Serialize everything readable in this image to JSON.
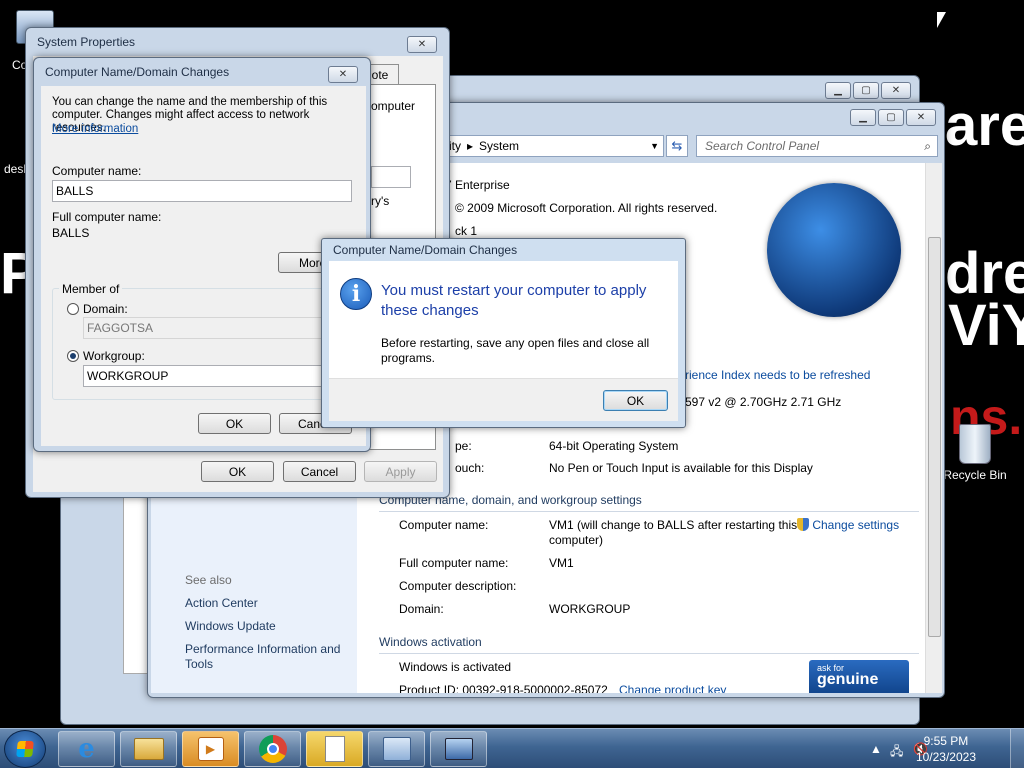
{
  "desktop": {
    "bg_text_1": "are!",
    "bg_text_2": "dres",
    "bg_text_3": "ViY",
    "bg_text_4": "ns.",
    "bg_text_left": "P",
    "icon_computer_label": "Co",
    "icon_desk_label": "desk",
    "recycle_bin_label": "Recycle Bin"
  },
  "control_panel": {
    "address_segment_1": "rity",
    "address_separator": "▸",
    "address_segment_2": "System",
    "search_placeholder": "Search Control Panel",
    "edition": "7 Enterprise",
    "copyright": "© 2009 Microsoft Corporation.  All rights reserved.",
    "service_pack": "ck 1",
    "experience_link": "rience Index needs to be refreshed",
    "processor_value": "597 v2 @ 2.70GHz   2.71 GHz",
    "system_type_label": "pe:",
    "system_type_value": "64-bit Operating System",
    "pen_label": "ouch:",
    "pen_value": "No Pen or Touch Input is available for this Display",
    "section_computer": "Computer name, domain, and workgroup settings",
    "computer_name_label": "Computer name:",
    "computer_name_value": "VM1 (will change to BALLS after restarting this computer)",
    "change_settings": "Change settings",
    "full_name_label": "Full computer name:",
    "full_name_value": "VM1",
    "description_label": "Computer description:",
    "domain_label": "Domain:",
    "domain_value": "WORKGROUP",
    "section_activation": "Windows activation",
    "activated_text": "Windows is activated",
    "product_id": "Product ID: 00392-918-5000002-85072",
    "change_product_key": "Change product key",
    "genuine_top": "ask for",
    "genuine_main": "genuine",
    "see_also": "See also",
    "see_also_items": [
      "Action Center",
      "Windows Update",
      "Performance Information and Tools"
    ]
  },
  "system_properties": {
    "title": "System Properties",
    "tab_fragment": "note",
    "side_text_1": "omputer",
    "side_text_2": "ry's",
    "ok": "OK",
    "cancel": "Cancel",
    "apply": "Apply"
  },
  "name_changes": {
    "title": "Computer Name/Domain Changes",
    "intro": "You can change the name and the membership of this computer. Changes might affect access to network resources.",
    "more_info": "More information",
    "computer_name_label": "Computer name:",
    "computer_name_value": "BALLS",
    "full_name_label": "Full computer name:",
    "full_name_value": "BALLS",
    "more_button": "More...",
    "member_of": "Member of",
    "domain_label": "Domain:",
    "domain_value": "FAGGOTSA",
    "workgroup_label": "Workgroup:",
    "workgroup_value": "WORKGROUP",
    "ok": "OK",
    "cancel": "Cancel"
  },
  "restart_dialog": {
    "title": "Computer Name/Domain Changes",
    "heading": "You must restart your computer to apply these changes",
    "body": "Before restarting, save any open files and close all programs.",
    "ok": "OK"
  },
  "taskbar": {
    "time": "9:55 PM",
    "date": "10/23/2023"
  }
}
